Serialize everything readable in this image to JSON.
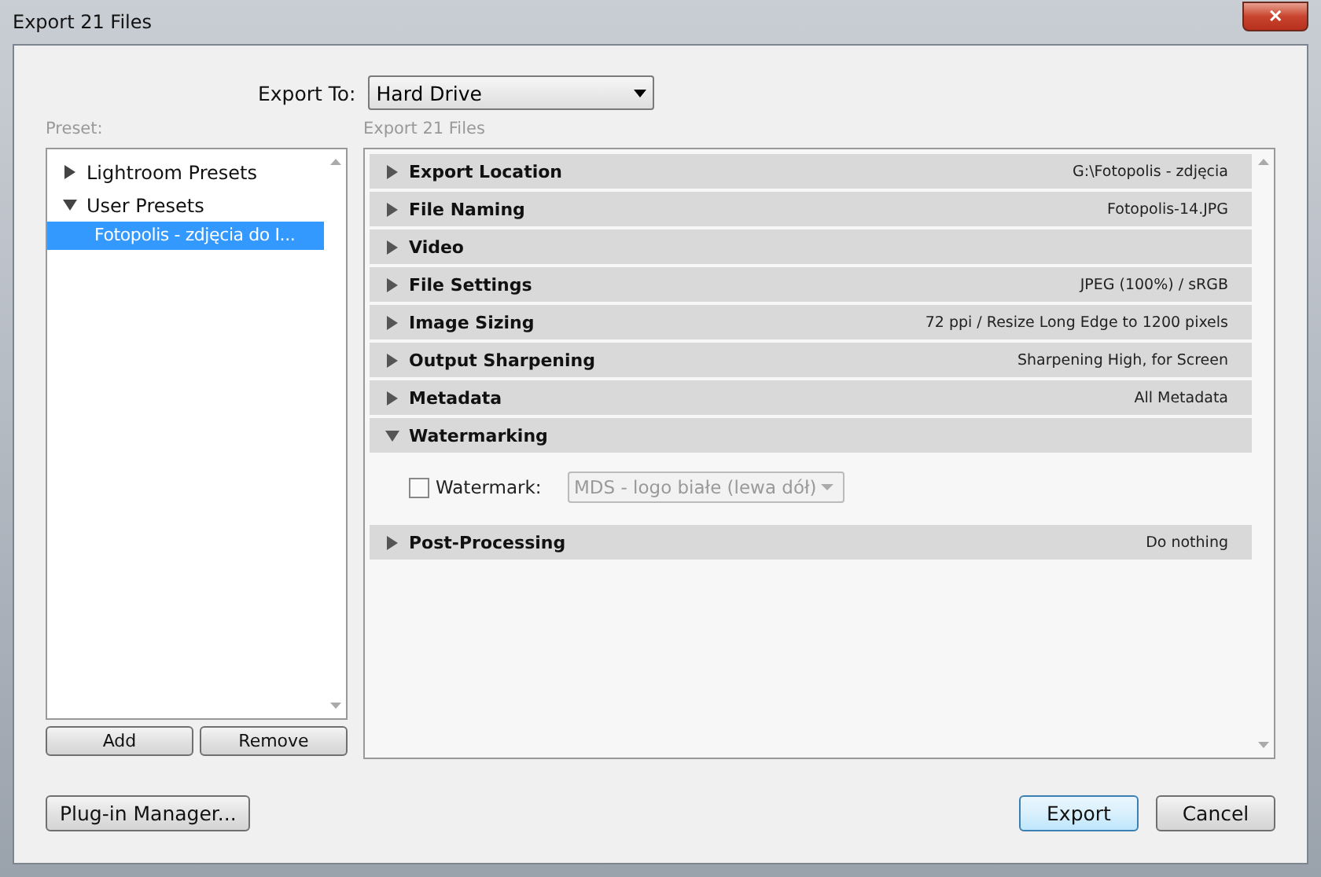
{
  "window": {
    "title": "Export 21 Files",
    "close": "✕"
  },
  "export_to": {
    "label": "Export To:",
    "value": "Hard Drive"
  },
  "preset_label": "Preset:",
  "presets": [
    {
      "label": "Lightroom Presets",
      "expanded": false,
      "selected": false
    },
    {
      "label": "User Presets",
      "expanded": true,
      "selected": false,
      "children": [
        {
          "label": "Fotopolis - zdjęcia do I...",
          "selected": true
        }
      ]
    }
  ],
  "preset_buttons": [
    "Add",
    "Remove"
  ],
  "sections_label": "Export 21 Files",
  "sections": [
    {
      "title": "Export Location",
      "summary": "G:\\Fotopolis - zdjęcia",
      "expanded": false
    },
    {
      "title": "File Naming",
      "summary": "Fotopolis-14.JPG",
      "expanded": false
    },
    {
      "title": "Video",
      "expanded": false
    },
    {
      "title": "File Settings",
      "summary": "JPEG (100%) / sRGB",
      "expanded": false
    },
    {
      "title": "Image Sizing",
      "summary": "72 ppi / Resize Long Edge to 1200 pixels",
      "expanded": false
    },
    {
      "title": "Output Sharpening",
      "summary": "Sharpening High, for Screen",
      "expanded": false
    },
    {
      "title": "Metadata",
      "summary": "All Metadata",
      "expanded": false
    },
    {
      "title": "Watermarking",
      "expanded": true,
      "content": {
        "checkbox_label": "Watermark:",
        "checked": false,
        "select_value": "MDS - logo białe (lewa dół)",
        "disabled": true
      }
    },
    {
      "title": "Post-Processing",
      "summary": "Do nothing",
      "expanded": false
    }
  ],
  "plugin_button": "Plug-in Manager...",
  "buttons": [
    {
      "label": "Export",
      "default": true
    },
    {
      "label": "Cancel",
      "default": false
    }
  ]
}
